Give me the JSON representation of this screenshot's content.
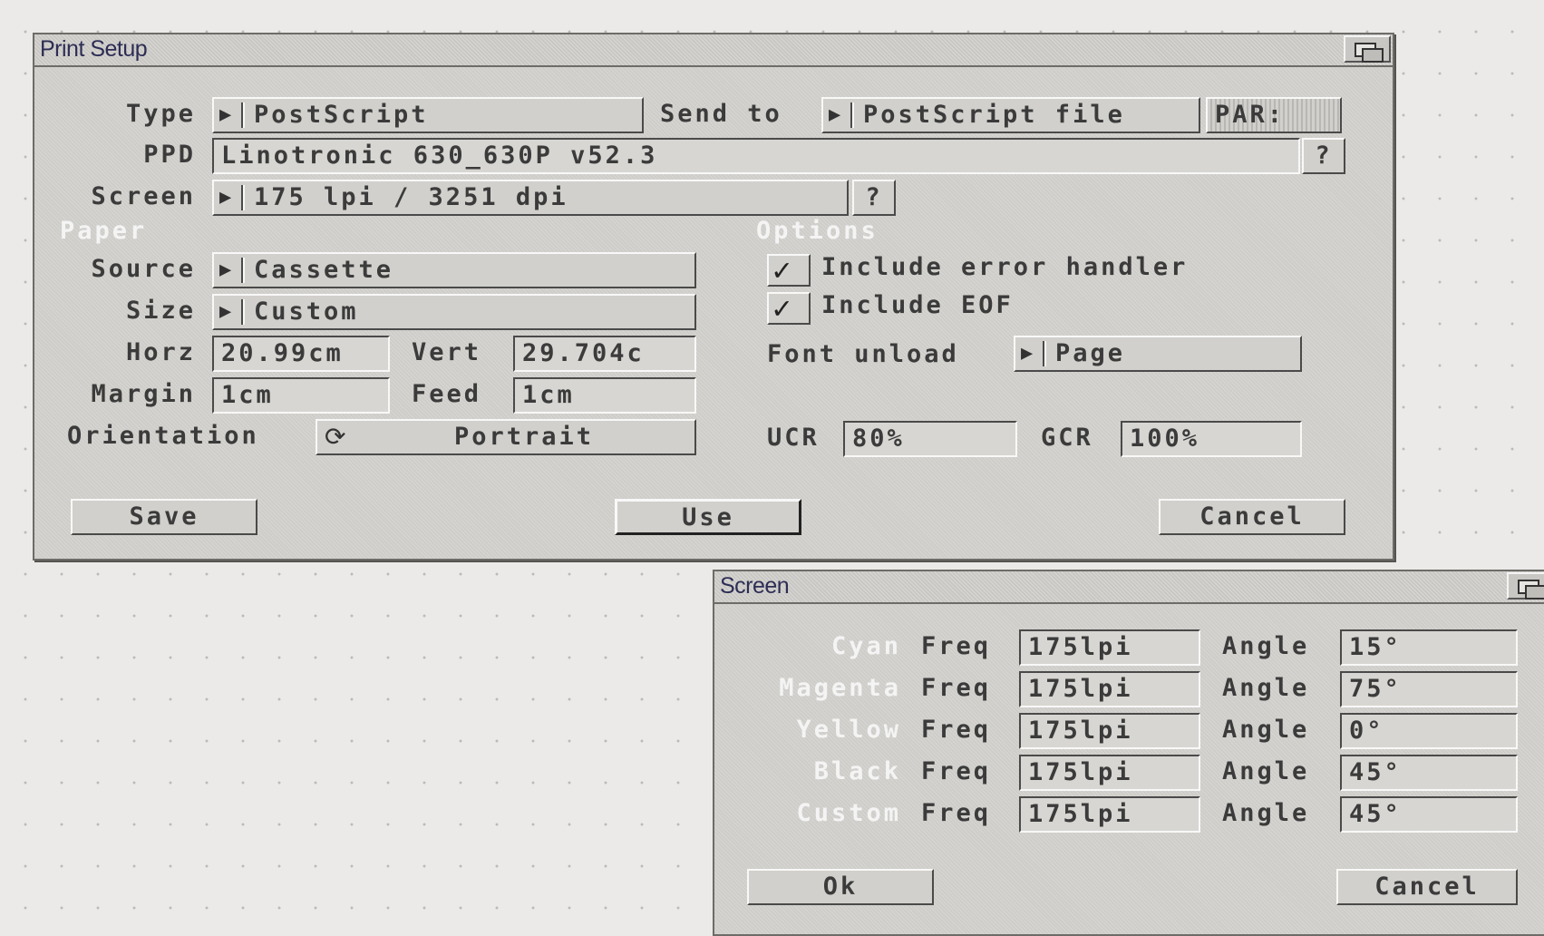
{
  "print_setup": {
    "title": "Print Setup",
    "type_label": "Type",
    "type_value": "PostScript",
    "send_to_label": "Send to",
    "send_to_value": "PostScript file",
    "par_button": "PAR:",
    "ppd_label": "PPD",
    "ppd_value": "Linotronic 630_630P v52.3",
    "ppd_help": "?",
    "screen_label": "Screen",
    "screen_value": "175 lpi / 3251 dpi",
    "screen_help": "?",
    "paper_heading": "Paper",
    "source_label": "Source",
    "source_value": "Cassette",
    "size_label": "Size",
    "size_value": "Custom",
    "horz_label": "Horz",
    "horz_value": "20.99cm",
    "vert_label": "Vert",
    "vert_value": "29.704c",
    "margin_label": "Margin",
    "margin_value": "1cm",
    "feed_label": "Feed",
    "feed_value": "1cm",
    "orientation_label": "Orientation",
    "orientation_value": "Portrait",
    "options_heading": "Options",
    "include_error_handler": "Include error handler",
    "include_eof": "Include EOF",
    "font_unload_label": "Font unload",
    "font_unload_value": "Page",
    "ucr_label": "UCR",
    "ucr_value": "80%",
    "gcr_label": "GCR",
    "gcr_value": "100%",
    "save_button": "Save",
    "use_button": "Use",
    "cancel_button": "Cancel"
  },
  "screen_dialog": {
    "title": "Screen",
    "freq_label": "Freq",
    "angle_label": "Angle",
    "rows": [
      {
        "color": "Cyan",
        "freq": "175lpi",
        "angle": "15°"
      },
      {
        "color": "Magenta",
        "freq": "175lpi",
        "angle": "75°"
      },
      {
        "color": "Yellow",
        "freq": "175lpi",
        "angle": "0°"
      },
      {
        "color": "Black",
        "freq": "175lpi",
        "angle": "45°"
      },
      {
        "color": "Custom",
        "freq": "175lpi",
        "angle": "45°"
      }
    ],
    "ok_button": "Ok",
    "cancel_button": "Cancel"
  },
  "icons": {
    "cycle_glyph": "▶",
    "orientation_glyph": "⟳",
    "check_glyph": "✓"
  }
}
